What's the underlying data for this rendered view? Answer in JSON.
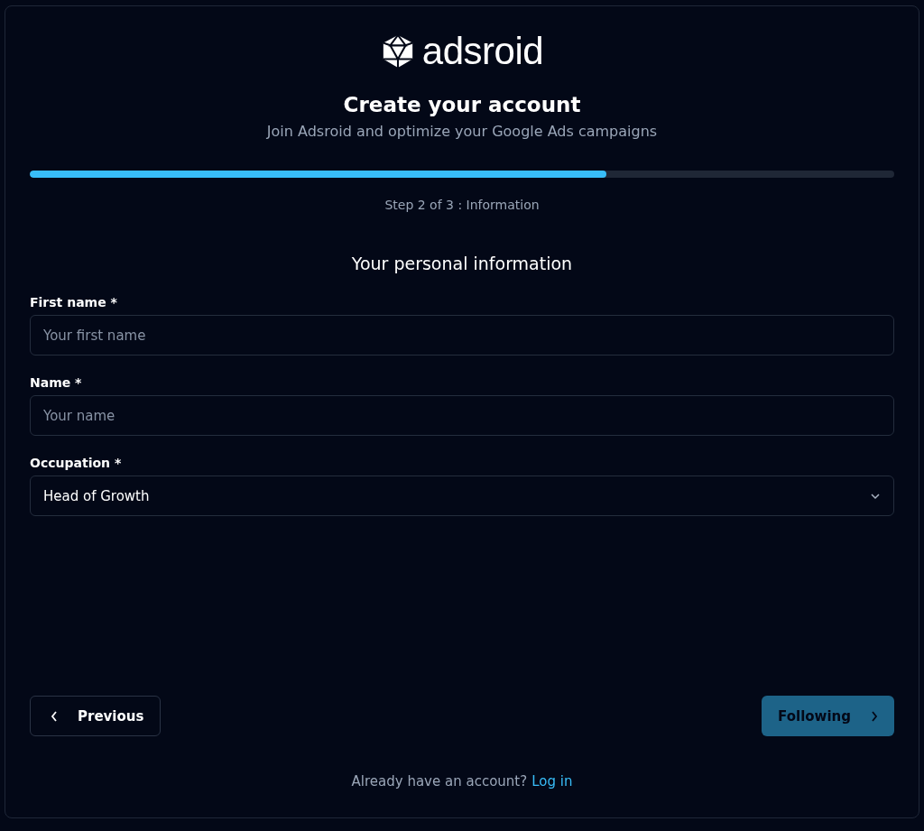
{
  "logo": {
    "text": "adsroid"
  },
  "title": "Create your account",
  "subtitle": "Join Adsroid and optimize your Google Ads campaigns",
  "progress": {
    "level": 0.667,
    "caption": "Step 2 of 3 : Information"
  },
  "section_title": "Your personal information",
  "fields": [
    {
      "kind": "text",
      "label": "First name *",
      "placeholder": "Your first name"
    },
    {
      "kind": "text",
      "label": "Name *",
      "placeholder": "Your name"
    },
    {
      "kind": "select",
      "label": "Occupation *",
      "value": "Head of Growth"
    }
  ],
  "buttons": [
    {
      "kind": "back",
      "label": "Previous",
      "disabled": false
    },
    {
      "kind": "next",
      "label": "Following",
      "disabled": true
    }
  ],
  "footer": {
    "text": "Already have an account?",
    "link": "Log in"
  }
}
